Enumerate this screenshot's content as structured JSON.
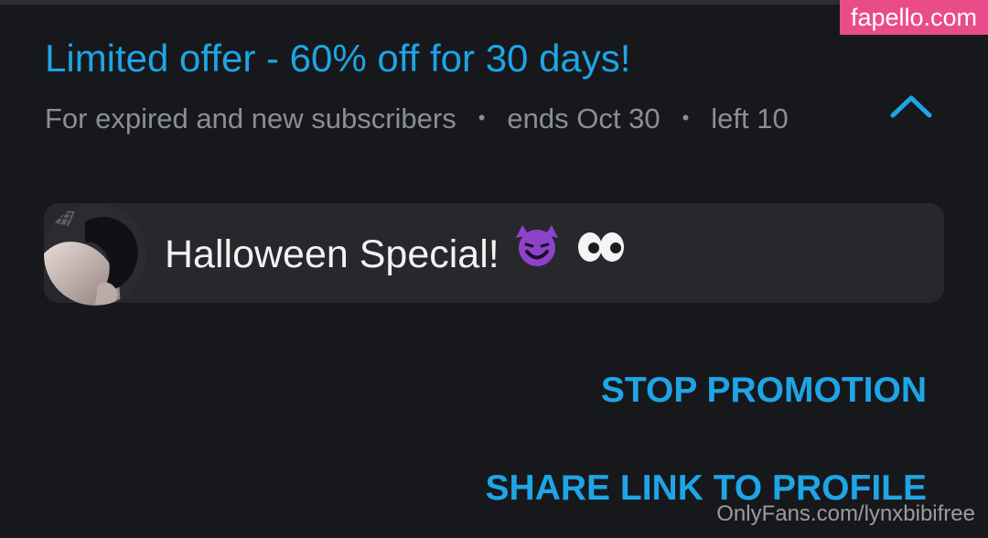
{
  "watermark_top": "fapello.com",
  "offer": {
    "title": "Limited offer - 60% off for 30 days!",
    "audience": "For expired and new subscribers",
    "separator": "•",
    "ends": "ends Oct 30",
    "left_label": "left",
    "left_count": "10"
  },
  "message": {
    "text": "Halloween Special!",
    "emojis": [
      "smiling-devil-icon",
      "eyes-icon"
    ]
  },
  "actions": {
    "stop_promotion": "STOP PROMOTION",
    "share_link": "SHARE LINK TO PROFILE"
  },
  "watermark_bottom": "OnlyFans.com/lynxbibifree",
  "colors": {
    "accent": "#1ea5e6",
    "background": "#17181b",
    "card": "#26282c",
    "meta_text": "#8b8e94",
    "watermark_pink": "#ea4c89"
  },
  "icons": {
    "collapse": "chevron-up-icon"
  }
}
